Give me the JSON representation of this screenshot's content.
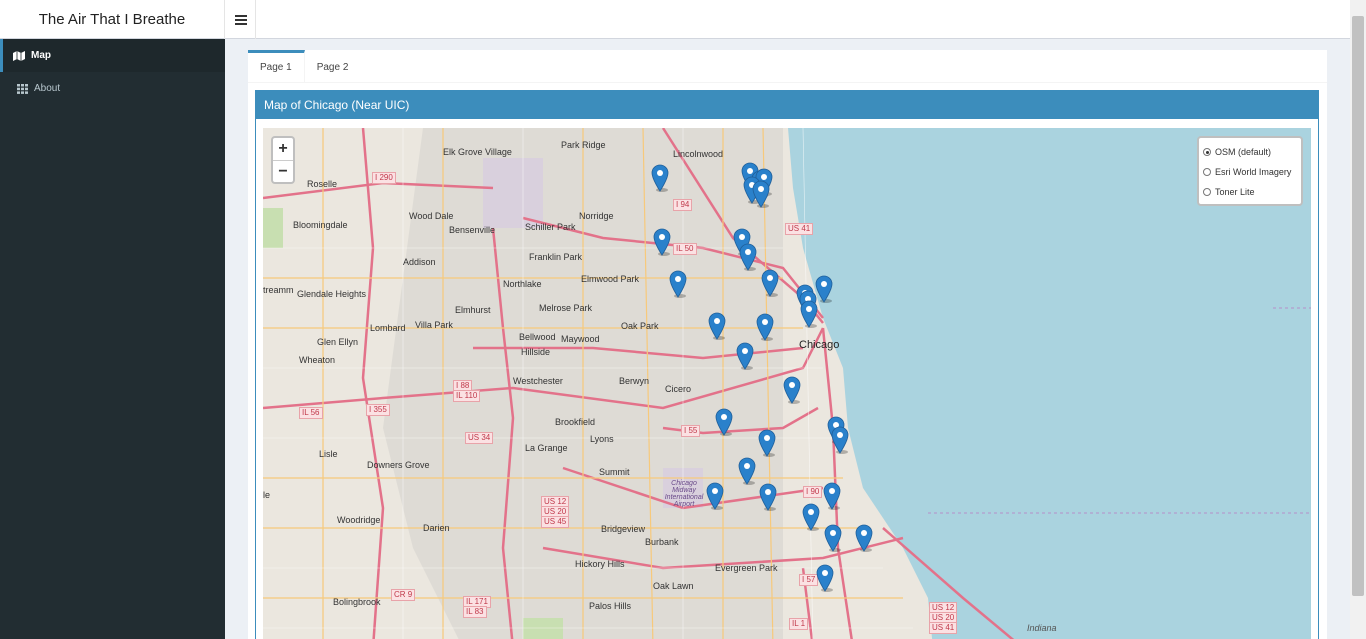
{
  "app": {
    "title": "The Air That I Breathe",
    "menu_icon": "hamburger-icon"
  },
  "sidebar": {
    "items": [
      {
        "label": "Map",
        "icon": "map-icon",
        "active": true
      },
      {
        "label": "About",
        "icon": "grid-icon",
        "active": false
      }
    ]
  },
  "tabs": [
    {
      "label": "Page 1",
      "active": true
    },
    {
      "label": "Page 2",
      "active": false
    }
  ],
  "panel": {
    "title": "Map of Chicago (Near UIC)"
  },
  "map": {
    "zoom_in": "+",
    "zoom_out": "−",
    "layers": [
      {
        "label": "OSM (default)",
        "selected": true
      },
      {
        "label": "Esri World Imagery",
        "selected": false
      },
      {
        "label": "Toner Lite",
        "selected": false
      }
    ],
    "place_labels": [
      "Park Ridge",
      "Lincolnwood",
      "Elk Grove Village",
      "Roselle",
      "Wood Dale",
      "Bensenville",
      "Schiller Park",
      "Norridge",
      "Bloomingdale",
      "Addison",
      "Franklin Park",
      "Elmwood Park",
      "Glendale Heights",
      "Northlake",
      "Elmhurst",
      "Melrose Park",
      "Oak Park",
      "Lombard",
      "Villa Park",
      "Glen Ellyn",
      "Bellwood",
      "Maywood",
      "Hillside",
      "Chicago",
      "Wheaton",
      "Westchester",
      "Berwyn",
      "Cicero",
      "Brookfield",
      "Lyons",
      "La Grange",
      "Lisle",
      "Downers Grove",
      "Summit",
      "Woodridge",
      "Darien",
      "Bridgeview",
      "Burbank",
      "Evergreen Park",
      "Hickory Hills",
      "Oak Lawn",
      "Bolingbrook",
      "Palos Hills",
      "Chicago Midway International Airport",
      "treamm",
      "le",
      "Indiana"
    ],
    "shields": [
      "I 290",
      "I 94",
      "US 41",
      "IL 50",
      "I 90",
      "I 88",
      "IL 110",
      "IL 56",
      "I 355",
      "US 34",
      "I 55",
      "US 12",
      "US 20",
      "US 45",
      "I 57",
      "CR 9",
      "IL 171",
      "IL 83",
      "IL 1",
      "US 12",
      "US 20",
      "US 41"
    ],
    "marker_count": 26
  },
  "colors": {
    "accent": "#3c8dbc",
    "sidebar": "#222d32",
    "marker": "#2a81cb",
    "water": "#aad3df"
  }
}
